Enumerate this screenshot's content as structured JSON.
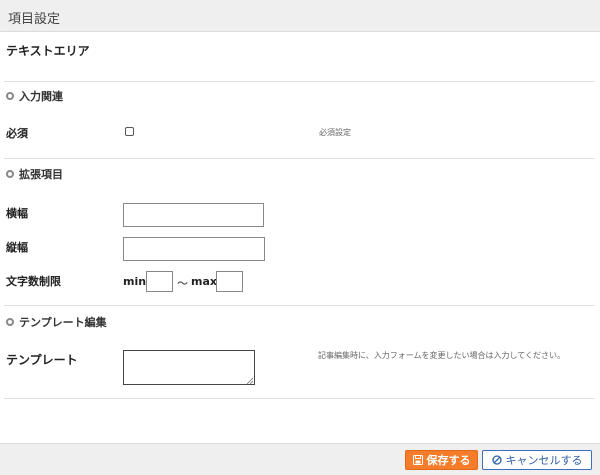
{
  "header": {
    "title": "項目設定"
  },
  "item": {
    "name": "テキストエリア"
  },
  "sections": {
    "input": {
      "title": "入力関連"
    },
    "extension": {
      "title": "拡張項目"
    },
    "template": {
      "title": "テンプレート編集"
    }
  },
  "required": {
    "label": "必須",
    "hint": "必須設定",
    "checked": false
  },
  "width": {
    "label": "横幅",
    "value": ""
  },
  "height": {
    "label": "縦幅",
    "value": ""
  },
  "char_limit": {
    "label": "文字数制限",
    "min_label": "min",
    "separator": "〜",
    "max_label": "max",
    "min_value": "",
    "max_value": ""
  },
  "template_field": {
    "label": "テンプレート",
    "value": "",
    "hint": "記事編集時に、入力フォームを変更したい場合は入力してください。"
  },
  "footer": {
    "save_label": "保存する",
    "cancel_label": "キャンセルする"
  },
  "colors": {
    "save_bg": "#f47c2a",
    "cancel_border": "#3f6fb8",
    "header_bg": "#efefef"
  }
}
